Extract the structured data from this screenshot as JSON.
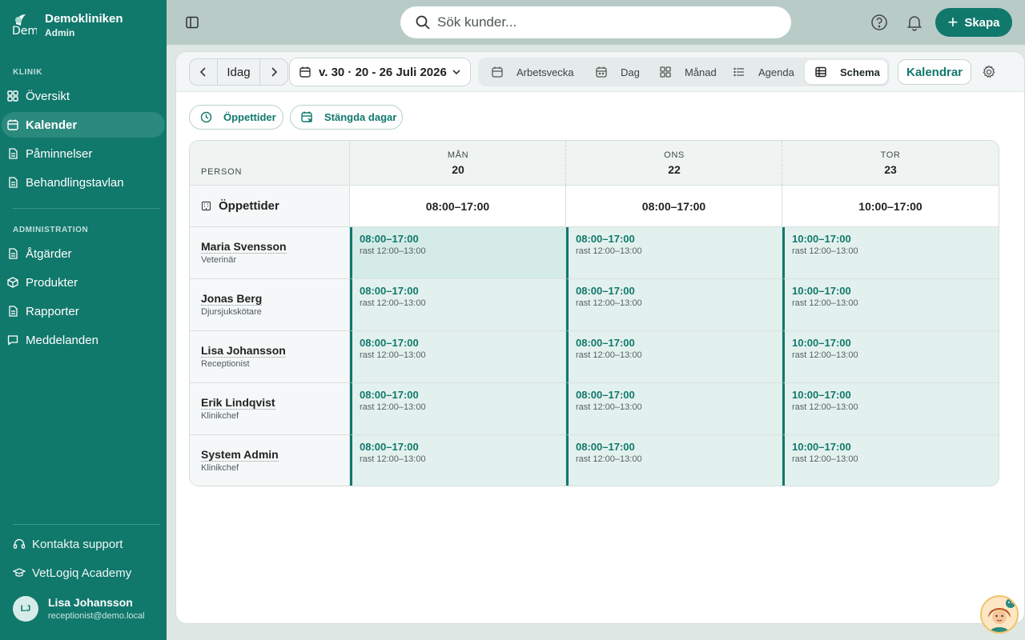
{
  "brand": {
    "name": "Demokliniken",
    "role": "Admin",
    "logo_text": "Dem"
  },
  "sidebar": {
    "section_clinic": "KLINIK",
    "section_admin": "ADMINISTRATION",
    "clinic_items": [
      {
        "label": "Översikt",
        "icon": "grid-icon"
      },
      {
        "label": "Kalender",
        "icon": "calendar-icon",
        "active": true
      },
      {
        "label": "Påminnelser",
        "icon": "document-icon"
      },
      {
        "label": "Behandlingstavlan",
        "icon": "document-icon"
      }
    ],
    "admin_items": [
      {
        "label": "Åtgärder",
        "icon": "document-icon"
      },
      {
        "label": "Produkter",
        "icon": "box-icon"
      },
      {
        "label": "Rapporter",
        "icon": "document-icon"
      },
      {
        "label": "Meddelanden",
        "icon": "chat-icon"
      }
    ],
    "support": {
      "label": "Kontakta support",
      "icon": "headset-icon"
    },
    "academy": {
      "label": "VetLogiq Academy",
      "icon": "graduation-cap-icon"
    },
    "user": {
      "initials": "LJ",
      "name": "Lisa Johansson",
      "email": "receptionist@demo.local"
    }
  },
  "topbar": {
    "search_placeholder": "Sök kunder...",
    "create_label": "Skapa"
  },
  "toolbar": {
    "today_label": "Idag",
    "week_label": "v. 30 · 20 - 26 Juli 2026",
    "views": [
      {
        "label": "Arbetsvecka",
        "icon": "calendar-icon"
      },
      {
        "label": "Dag",
        "icon": "calendar-day-icon"
      },
      {
        "label": "Månad",
        "icon": "grid-icon"
      },
      {
        "label": "Agenda",
        "icon": "list-icon"
      },
      {
        "label": "Schema",
        "icon": "table-icon",
        "active": true
      }
    ],
    "calendars_label": "Kalendrar"
  },
  "chips": {
    "opening_hours": "Öppettider",
    "closed_days": "Stängda dagar"
  },
  "schedule": {
    "person_header": "PERSON",
    "hours_row_label": "Öppettider",
    "days": [
      {
        "dow": "MÅN",
        "num": "20",
        "hours": "08:00–17:00"
      },
      {
        "dow": "ONS",
        "num": "22",
        "hours": "08:00–17:00"
      },
      {
        "dow": "TOR",
        "num": "23",
        "hours": "10:00–17:00"
      }
    ],
    "people": [
      {
        "name": "Maria Svensson",
        "role": "Veterinär",
        "shifts": [
          {
            "time": "08:00–17:00",
            "break": "rast 12:00–13:00"
          },
          {
            "time": "08:00–17:00",
            "break": "rast 12:00–13:00"
          },
          {
            "time": "10:00–17:00",
            "break": "rast 12:00–13:00"
          }
        ]
      },
      {
        "name": "Jonas Berg",
        "role": "Djursjukskötare",
        "shifts": [
          {
            "time": "08:00–17:00",
            "break": "rast 12:00–13:00"
          },
          {
            "time": "08:00–17:00",
            "break": "rast 12:00–13:00"
          },
          {
            "time": "10:00–17:00",
            "break": "rast 12:00–13:00"
          }
        ]
      },
      {
        "name": "Lisa Johansson",
        "role": "Receptionist",
        "shifts": [
          {
            "time": "08:00–17:00",
            "break": "rast 12:00–13:00"
          },
          {
            "time": "08:00–17:00",
            "break": "rast 12:00–13:00"
          },
          {
            "time": "10:00–17:00",
            "break": "rast 12:00–13:00"
          }
        ]
      },
      {
        "name": "Erik Lindqvist",
        "role": "Klinikchef",
        "shifts": [
          {
            "time": "08:00–17:00",
            "break": "rast 12:00–13:00"
          },
          {
            "time": "08:00–17:00",
            "break": "rast 12:00–13:00"
          },
          {
            "time": "10:00–17:00",
            "break": "rast 12:00–13:00"
          }
        ]
      },
      {
        "name": "System Admin",
        "role": "Klinikchef",
        "shifts": [
          {
            "time": "08:00–17:00",
            "break": "rast 12:00–13:00"
          },
          {
            "time": "08:00–17:00",
            "break": "rast 12:00–13:00"
          },
          {
            "time": "10:00–17:00",
            "break": "rast 12:00–13:00"
          }
        ]
      }
    ]
  },
  "colors": {
    "accent": "#11786c",
    "sidebar_bg": "#11786c",
    "shift_bg": "#e3f1ee"
  }
}
